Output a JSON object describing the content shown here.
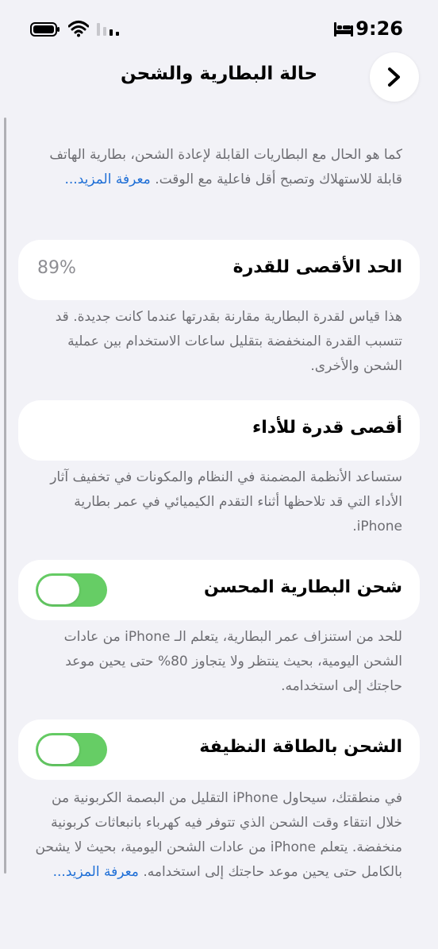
{
  "status_bar": {
    "time": "9:26",
    "icons": [
      "bed-icon",
      "battery-icon",
      "wifi-icon",
      "cellular-signal-icon"
    ]
  },
  "nav": {
    "title": "حالة البطارية والشحن",
    "back_icon": "chevron-right-icon"
  },
  "intro": {
    "text": "كما هو الحال مع البطاريات القابلة لإعادة الشحن، بطارية الهاتف قابلة للاستهلاك وتصبح أقل فاعلية مع الوقت.",
    "learn_more": "معرفة المزيد..."
  },
  "maximum_capacity": {
    "label": "الحد الأقصى للقدرة",
    "value": "89%",
    "footnote": "هذا قياس لقدرة البطارية مقارنة بقدرتها عندما كانت جديدة. قد تتسبب القدرة المنخفضة بتقليل ساعات الاستخدام بين عملية الشحن والأخرى."
  },
  "peak_performance": {
    "label": "أقصى قدرة للأداء",
    "footnote": "ستساعد الأنظمة المضمنة في النظام والمكونات في تخفيف آثار الأداء التي قد تلاحظها أثناء التقدم الكيميائي في عمر بطارية iPhone."
  },
  "optimized_charging": {
    "label": "شحن البطارية المحسن",
    "enabled": true,
    "footnote": "للحد من استنزاف عمر البطارية، يتعلم الـ iPhone من عادات الشحن اليومية، بحيث ينتظر ولا يتجاوز 80% حتى يحين موعد حاجتك إلى استخدامه."
  },
  "clean_energy": {
    "label": "الشحن بالطاقة النظيفة",
    "enabled": true,
    "footnote": "في منطقتك، سيحاول iPhone التقليل من البصمة الكربونية من خلال انتقاء وقت الشحن الذي تتوفر فيه كهرباء بانبعاثات كربونية منخفضة. يتعلم iPhone من عادات الشحن اليومية، بحيث لا يشحن بالكامل حتى يحين موعد حاجتك إلى استخدامه.",
    "learn_more": "معرفة المزيد..."
  },
  "colors": {
    "background": "#f2f2f7",
    "card": "#ffffff",
    "toggle_on": "#66cd65",
    "link": "#1f6fd6",
    "secondary_text": "#6d6d72"
  }
}
